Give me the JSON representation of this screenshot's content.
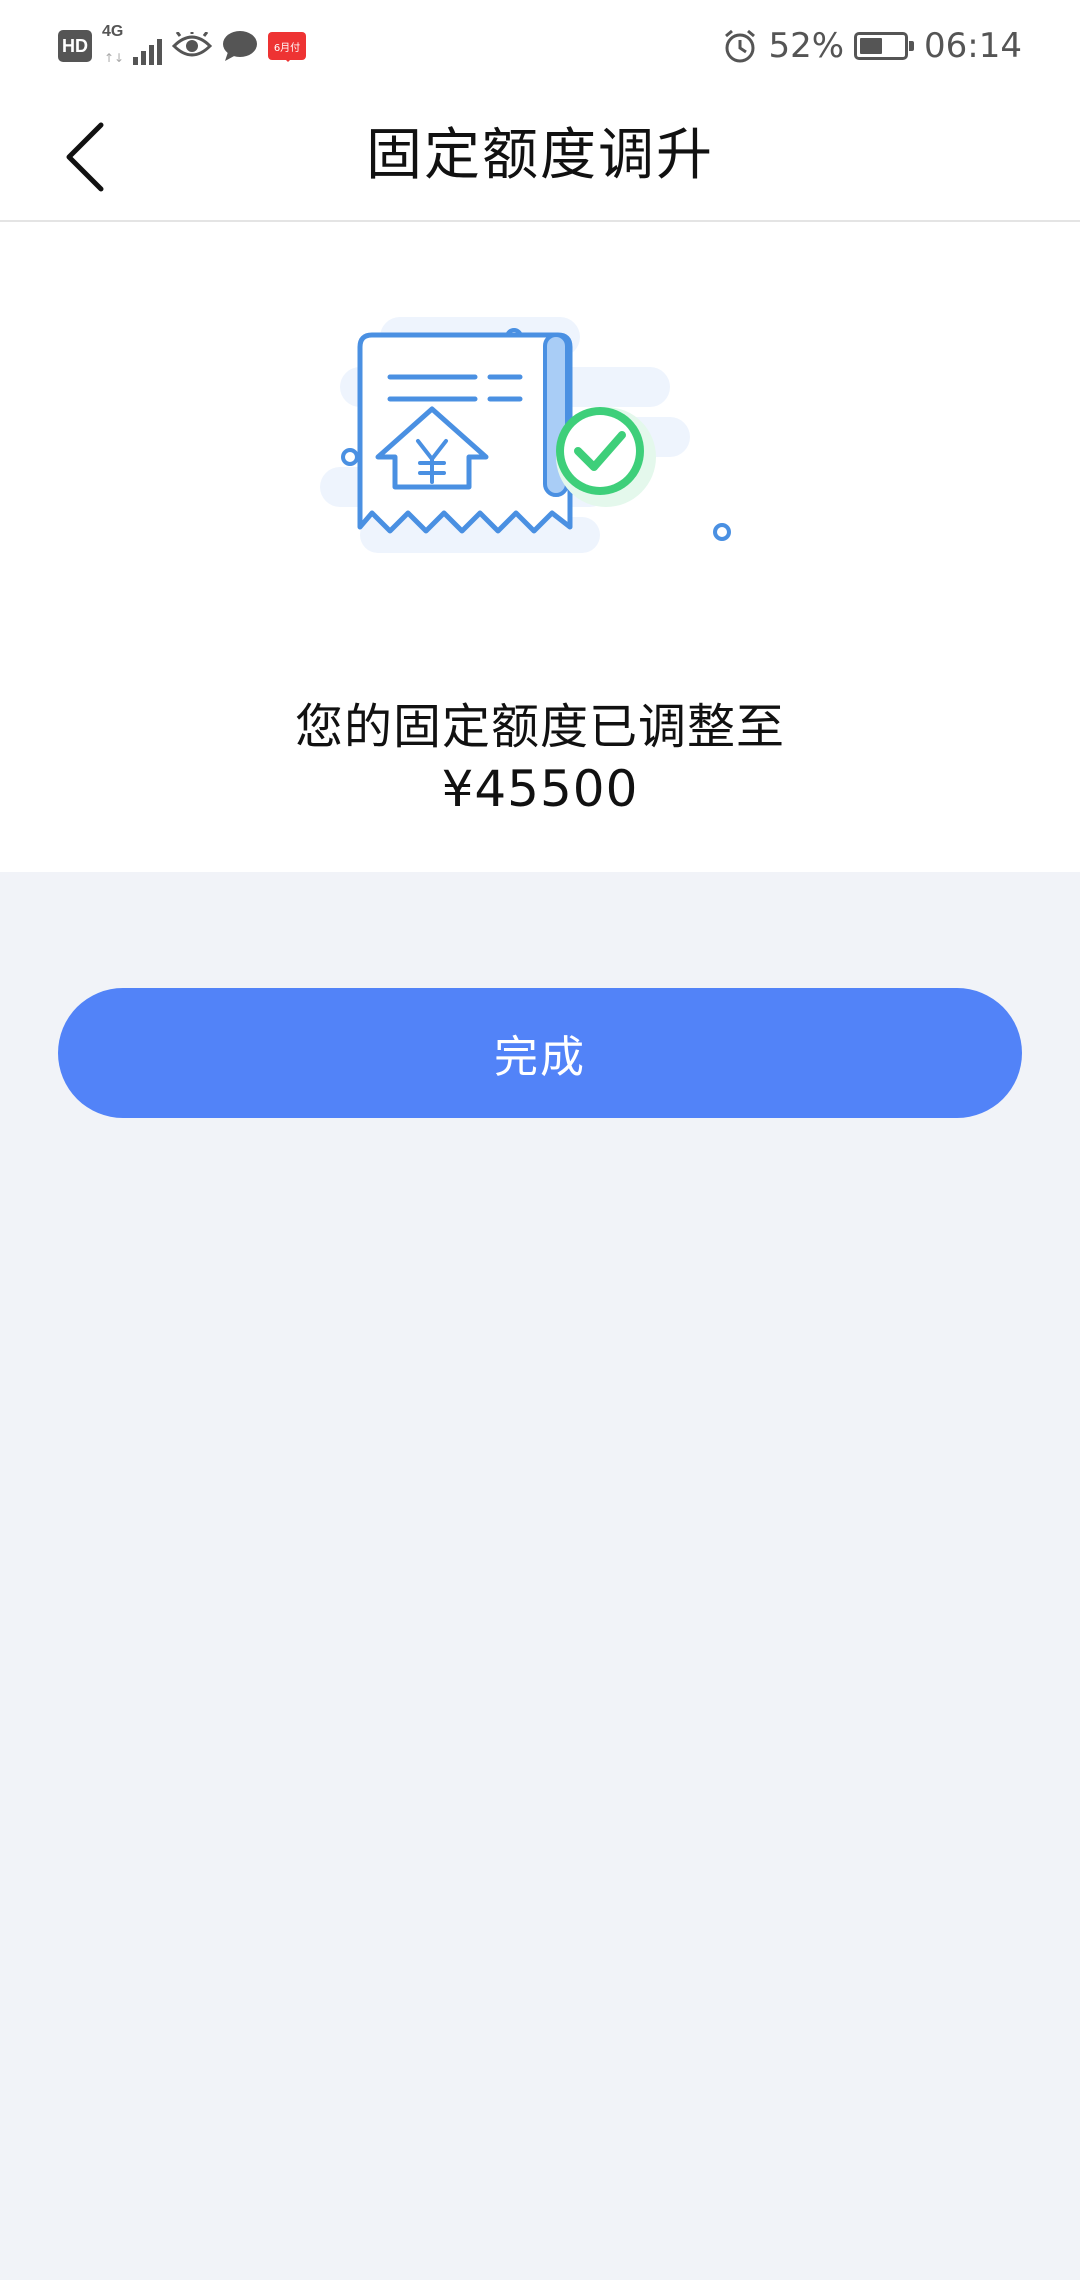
{
  "status_bar": {
    "hd": "HD",
    "network": "4G",
    "network_arrows": "↑↓",
    "app_badge": "6月付",
    "battery_percent": "52%",
    "battery_level": 0.52,
    "time": "06:14"
  },
  "nav": {
    "title": "固定额度调升",
    "back_icon": "chevron-left-icon"
  },
  "result": {
    "illustration_icon": "receipt-limit-raised-check-icon",
    "message": "您的固定额度已调整至",
    "amount": "¥45500"
  },
  "actions": {
    "done_label": "完成"
  },
  "colors": {
    "primary": "#5283f8",
    "background": "#f1f3f8",
    "illustration_blue": "#4a90e2",
    "success_green": "#3ecf7a"
  }
}
